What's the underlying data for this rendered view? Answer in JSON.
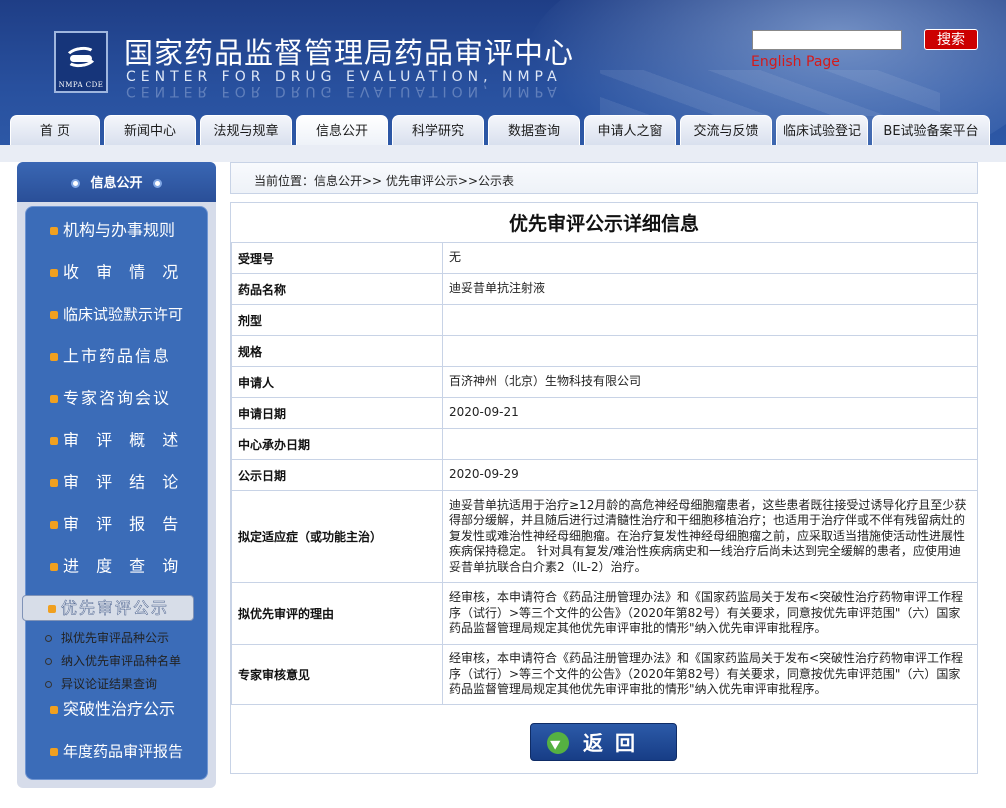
{
  "header": {
    "logo_caption": "NMPA CDE",
    "title_cn": "国家药品监督管理局药品审评中心",
    "title_en": "CENTER  FOR  DRUG  EVALUATION,  NMPA",
    "search_button": "搜索",
    "english_link": "English Page",
    "search_value": ""
  },
  "nav": [
    {
      "label": "首  页"
    },
    {
      "label": "新闻中心"
    },
    {
      "label": "法规与规章"
    },
    {
      "label": "信息公开"
    },
    {
      "label": "科学研究"
    },
    {
      "label": "数据查询"
    },
    {
      "label": "申请人之窗"
    },
    {
      "label": "交流与反馈"
    },
    {
      "label": "临床试验登记"
    },
    {
      "label": "BE试验备案平台"
    }
  ],
  "sidebar": {
    "heading": "信息公开",
    "items": [
      {
        "label": "机构与办事规则"
      },
      {
        "label": "收 审 情 况"
      },
      {
        "label": "临床试验默示许可"
      },
      {
        "label": "上市药品信息"
      },
      {
        "label": "专家咨询会议"
      },
      {
        "label": "审 评 概 述"
      },
      {
        "label": "审 评 结 论"
      },
      {
        "label": "审 评 报 告"
      },
      {
        "label": "进 度 查 询"
      },
      {
        "label": "优先审评公示"
      }
    ],
    "subitems": [
      {
        "label": "拟优先审评品种公示"
      },
      {
        "label": "纳入优先审评品种名单"
      },
      {
        "label": "异议论证结果查询"
      }
    ],
    "items_after": [
      {
        "label": "突破性治疗公示"
      },
      {
        "label": "年度药品审评报告"
      }
    ]
  },
  "breadcrumb": "当前位置：信息公开>> 优先审评公示>>公示表",
  "page_title": "优先审评公示详细信息",
  "details": [
    {
      "key": "受理号",
      "value": "无"
    },
    {
      "key": "药品名称",
      "value": "迪妥昔单抗注射液"
    },
    {
      "key": "剂型",
      "value": ""
    },
    {
      "key": "规格",
      "value": ""
    },
    {
      "key": "申请人",
      "value": "百济神州（北京）生物科技有限公司"
    },
    {
      "key": "申请日期",
      "value": "2020-09-21"
    },
    {
      "key": "中心承办日期",
      "value": ""
    },
    {
      "key": "公示日期",
      "value": "2020-09-29"
    },
    {
      "key": "拟定适应症（或功能主治）",
      "value": "迪妥昔单抗适用于治疗≥12月龄的高危神经母细胞瘤患者，这些患者既往接受过诱导化疗且至少获得部分缓解，并且随后进行过清髓性治疗和干细胞移植治疗；也适用于治疗伴或不伴有残留病灶的复发性或难治性神经母细胞瘤。在治疗复发性神经母细胞瘤之前，应采取适当措施使活动性进展性疾病保持稳定。 针对具有复发/难治性疾病病史和一线治疗后尚未达到完全缓解的患者，应使用迪妥昔单抗联合白介素2（IL-2）治疗。"
    },
    {
      "key": "拟优先审评的理由",
      "value": "经审核，本申请符合《药品注册管理办法》和《国家药监局关于发布<突破性治疗药物审评工作程序（试行）>等三个文件的公告》（2020年第82号）有关要求，同意按优先审评范围\"（六）国家药品监督管理局规定其他优先审评审批的情形\"纳入优先审评审批程序。"
    },
    {
      "key": "专家审核意见",
      "value": "经审核，本申请符合《药品注册管理办法》和《国家药监局关于发布<突破性治疗药物审评工作程序（试行）>等三个文件的公告》（2020年第82号）有关要求，同意按优先审评范围\"（六）国家药品监督管理局规定其他优先审评审批的情形\"纳入优先审评审批程序。"
    }
  ],
  "back_button": "返回"
}
